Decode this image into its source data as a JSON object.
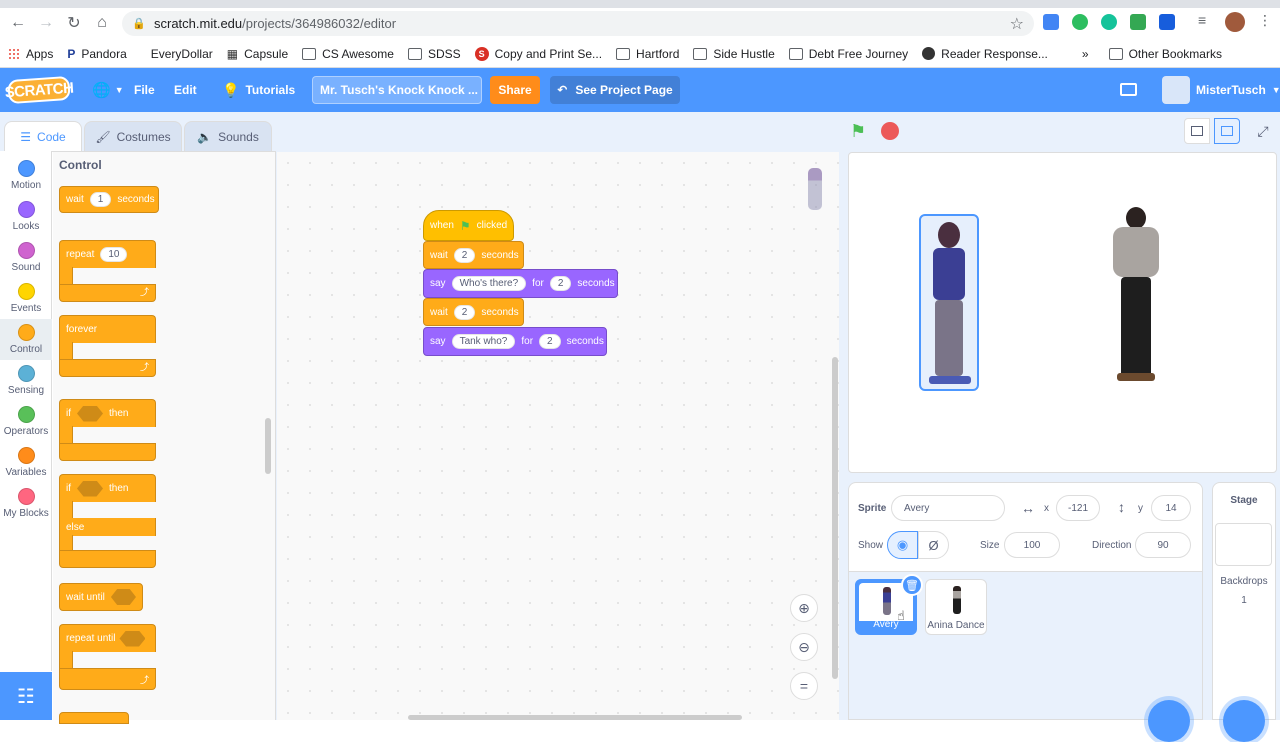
{
  "browser": {
    "url_host": "scratch.mit.edu",
    "url_path": "/projects/364986032/editor",
    "bookmarks": [
      "Apps",
      "Pandora",
      "EveryDollar",
      "Capsule",
      "CS Awesome",
      "SDSS",
      "Copy and Print Se...",
      "Hartford",
      "Side Hustle",
      "Debt Free Journey",
      "Reader Response..."
    ],
    "more_label": "»",
    "other_bookmarks": "Other Bookmarks"
  },
  "menu": {
    "logo": "SCRATCH",
    "file": "File",
    "edit": "Edit",
    "tutorials": "Tutorials",
    "project_title": "Mr. Tusch's Knock Knock ...",
    "share": "Share",
    "see_project": "See Project Page",
    "username": "MisterTusch"
  },
  "tabs": {
    "code": "Code",
    "costumes": "Costumes",
    "sounds": "Sounds"
  },
  "categories": [
    {
      "label": "Motion",
      "color": "#4c97ff"
    },
    {
      "label": "Looks",
      "color": "#9966ff"
    },
    {
      "label": "Sound",
      "color": "#cf63cf"
    },
    {
      "label": "Events",
      "color": "#ffd500"
    },
    {
      "label": "Control",
      "color": "#ffab19"
    },
    {
      "label": "Sensing",
      "color": "#5cb1d6"
    },
    {
      "label": "Operators",
      "color": "#59c059"
    },
    {
      "label": "Variables",
      "color": "#ff8c1a"
    },
    {
      "label": "My Blocks",
      "color": "#ff6680"
    }
  ],
  "palette": {
    "heading": "Control",
    "wait": "wait",
    "wait_val": "1",
    "seconds": "seconds",
    "repeat": "repeat",
    "repeat_val": "10",
    "forever": "forever",
    "if": "if",
    "then": "then",
    "else": "else",
    "wait_until": "wait until",
    "repeat_until": "repeat until"
  },
  "script": {
    "when": "when",
    "clicked": "clicked",
    "wait": "wait",
    "seconds": "seconds",
    "say": "say",
    "for": "for",
    "wait1": "2",
    "say1_text": "Who's there?",
    "say1_secs": "2",
    "wait2": "2",
    "say2_text": "Tank who?",
    "say2_secs": "2"
  },
  "sprite_info": {
    "sprite_label": "Sprite",
    "sprite_name": "Avery",
    "x_label": "x",
    "x": "-121",
    "y_label": "y",
    "y": "14",
    "show_label": "Show",
    "size_label": "Size",
    "size": "100",
    "direction_label": "Direction",
    "direction": "90"
  },
  "sprites": [
    {
      "name": "Avery"
    },
    {
      "name": "Anina Dance"
    }
  ],
  "stage_pane": {
    "title": "Stage",
    "backdrops_label": "Backdrops",
    "backdrops_count": "1"
  }
}
